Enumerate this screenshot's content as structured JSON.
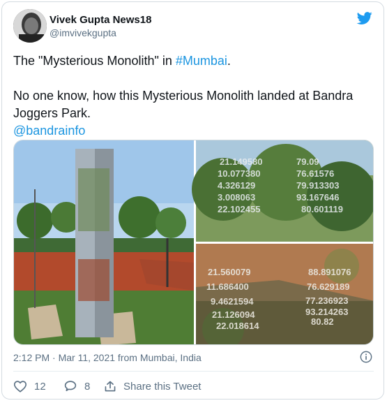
{
  "tweet": {
    "display_name": "Vivek Gupta News18",
    "handle": "@imvivekgupta",
    "line1_prefix": "The \"Mysterious Monolith\" in ",
    "line1_hashtag": "#Mumbai",
    "line1_suffix": ".",
    "line2": "No one know, how this Mysterious Monolith landed at Bandra Joggers Park.",
    "mention": "@bandrainfo",
    "timestamp": "2:12 PM · Mar 11, 2021 from Mumbai, India"
  },
  "actions": {
    "like_count": "12",
    "reply_count": "8",
    "share_label": "Share this Tweet"
  },
  "photo_numbers": {
    "top_left": [
      "21.149580",
      "10.077380",
      "4.326129",
      "3.008063",
      "22.102455"
    ],
    "top_right": [
      "79.09",
      "76.61576",
      "79.913303",
      "93.167646",
      "80.601119"
    ],
    "bottom_left": [
      "21.560079",
      "11.686400",
      "9.4621594",
      "21.126094",
      "22.018614"
    ],
    "bottom_right": [
      "88.891076",
      "76.629189",
      "77.236923",
      "93.214263",
      "80.82"
    ]
  },
  "colors": {
    "accent": "#1d9bf0",
    "link": "#1b95e0",
    "muted": "#5b7083",
    "text": "#0f1419"
  },
  "icons": [
    "twitter-bird-icon",
    "info-icon",
    "heart-icon",
    "reply-icon",
    "share-icon"
  ]
}
